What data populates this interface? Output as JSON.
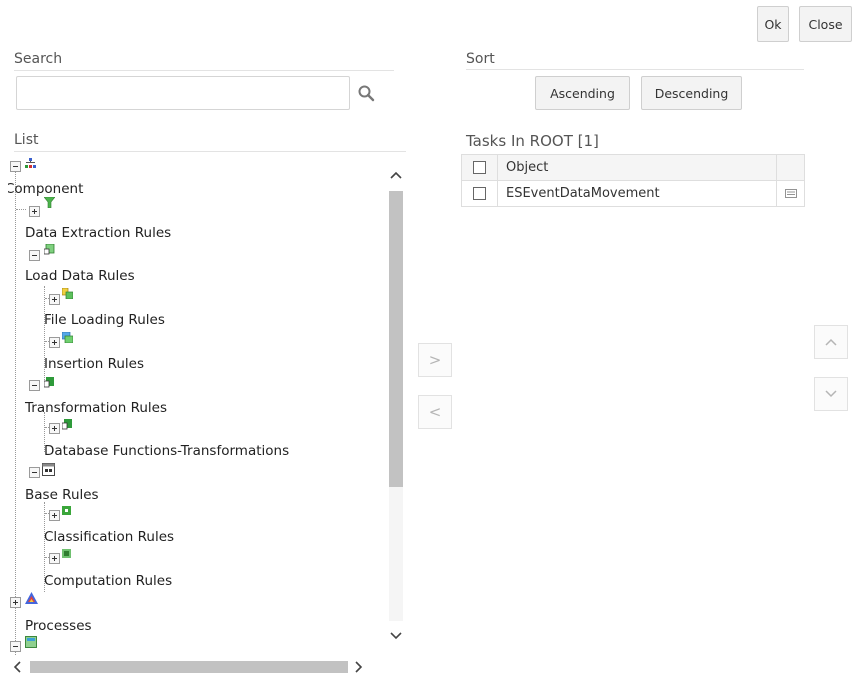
{
  "toolbar": {
    "ok_label": "Ok",
    "close_label": "Close"
  },
  "search": {
    "label": "Search",
    "value": "",
    "placeholder": ""
  },
  "sort": {
    "label": "Sort",
    "ascending_label": "Ascending",
    "descending_label": "Descending"
  },
  "list": {
    "label": "List",
    "items": [
      {
        "label": "Component",
        "icon": "root-hierarchy-icon",
        "toggle": "minus"
      },
      {
        "label": "Data Extraction Rules",
        "icon": "funnel-icon",
        "toggle": "plus"
      },
      {
        "label": "Load Data Rules",
        "icon": "database-icon",
        "toggle": "minus"
      },
      {
        "label": "File Loading Rules",
        "icon": "file-load-icon",
        "toggle": "plus"
      },
      {
        "label": "Insertion Rules",
        "icon": "insert-icon",
        "toggle": "plus"
      },
      {
        "label": "Transformation Rules",
        "icon": "transform-icon",
        "toggle": "minus"
      },
      {
        "label": "Database Functions-Transformations",
        "icon": "db-function-icon",
        "toggle": "plus"
      },
      {
        "label": "Base Rules",
        "icon": "base-rules-icon",
        "toggle": "minus"
      },
      {
        "label": "Classification Rules",
        "icon": "classification-icon",
        "toggle": "plus"
      },
      {
        "label": "Computation Rules",
        "icon": "computation-icon",
        "toggle": "plus"
      },
      {
        "label": "Processes",
        "icon": "process-triangle-icon",
        "toggle": "plus"
      },
      {
        "label": "",
        "icon": "folder-green-icon",
        "toggle": "minus"
      }
    ]
  },
  "move": {
    "right_glyph": ">",
    "left_glyph": "<",
    "up_glyph": "^",
    "down_glyph": "v"
  },
  "tasks": {
    "title": "Tasks In ROOT [1]",
    "column_header": "Object",
    "rows": [
      {
        "object": "ESEventDataMovement"
      }
    ]
  },
  "colors": {
    "border": "#d5d5d5",
    "button_bg": "#f3f3f3",
    "scroll_thumb": "#c2c2c2"
  }
}
